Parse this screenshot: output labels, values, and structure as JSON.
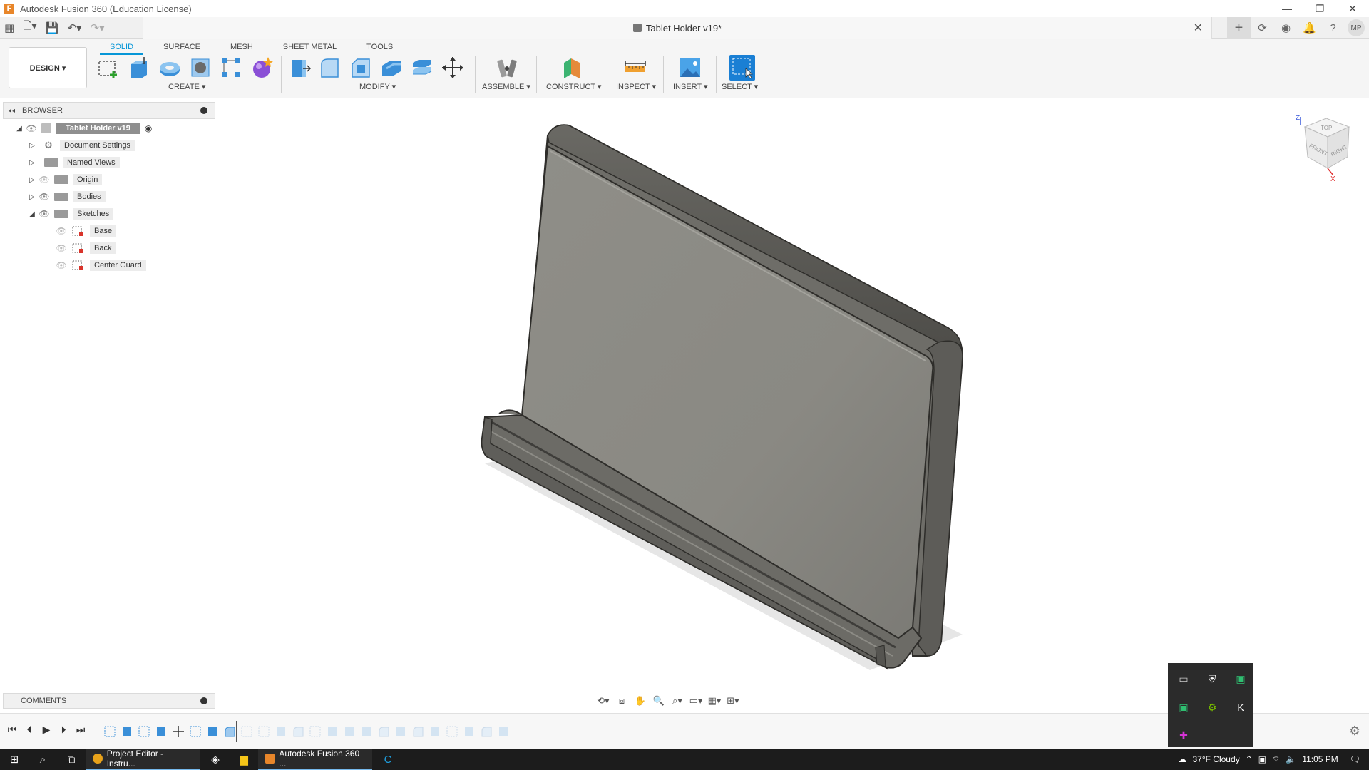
{
  "window": {
    "title": "Autodesk Fusion 360 (Education License)",
    "min": "—",
    "restore": "❐",
    "close": "✕"
  },
  "document_tab": {
    "title": "Tablet Holder v19*",
    "close": "✕"
  },
  "user": {
    "initials": "MP"
  },
  "workspace": {
    "label": "DESIGN ▾"
  },
  "ribbon": {
    "tabs": [
      "SOLID",
      "SURFACE",
      "MESH",
      "SHEET METAL",
      "TOOLS"
    ],
    "active_tab": "SOLID",
    "groups": {
      "create": "CREATE ▾",
      "modify": "MODIFY ▾",
      "assemble": "ASSEMBLE ▾",
      "construct": "CONSTRUCT ▾",
      "inspect": "INSPECT ▾",
      "insert": "INSERT ▾",
      "select": "SELECT ▾"
    }
  },
  "browser": {
    "title": "BROWSER",
    "root": "Tablet Holder v19",
    "items": [
      "Document Settings",
      "Named Views",
      "Origin",
      "Bodies",
      "Sketches"
    ],
    "sketches": [
      "Base",
      "Back",
      "Center Guard"
    ]
  },
  "comments": {
    "title": "COMMENTS"
  },
  "viewcube": {
    "top": "TOP",
    "front": "FRONT",
    "right": "RIGHT",
    "z": "Z",
    "x": "X"
  },
  "taskbar": {
    "apps": [
      {
        "label": "Project Editor - Instru...",
        "icon_color": "#e8a21a"
      },
      {
        "label": "Autodesk Fusion 360 ...",
        "icon_color": "#e8862a"
      }
    ],
    "weather": "37°F  Cloudy",
    "time": "11:05 PM"
  },
  "colors": {
    "accent": "#0696d7",
    "model_face": "#8a8a84",
    "model_edge": "#3e3c38",
    "taskbar": "#1c1c1c"
  }
}
